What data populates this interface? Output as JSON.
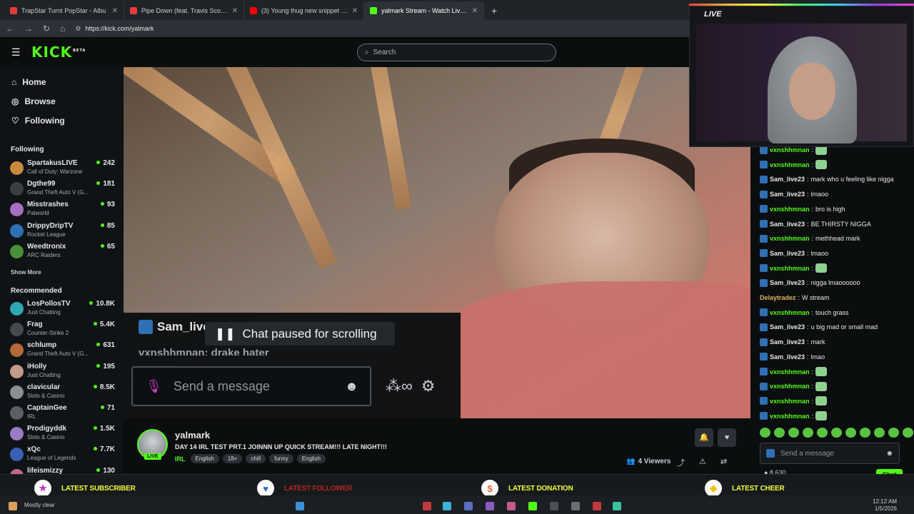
{
  "browser": {
    "tabs": [
      {
        "title": "TrapStar Turnt PopStar - Albu",
        "color": "#e63b3b"
      },
      {
        "title": "Pipe Down (feat. Travis Scott) - Sp",
        "color": "#e63b3b"
      },
      {
        "title": "(3) Young thug new snippet crazy",
        "color": "#ff0000"
      },
      {
        "title": "yalmark Stream - Watch Live on K",
        "color": "#53fc18"
      }
    ],
    "url": "https://kick.com/yalmark"
  },
  "header": {
    "logo": "KICK",
    "logo_badge": "BETA",
    "search_placeholder": "Search"
  },
  "sidebar": {
    "nav": [
      {
        "label": "Home",
        "icon": "home-icon"
      },
      {
        "label": "Browse",
        "icon": "compass-icon"
      },
      {
        "label": "Following",
        "icon": "heart-icon"
      }
    ],
    "following_title": "Following",
    "following": [
      {
        "name": "SpartakusLIVE",
        "game": "Call of Duty: Warzone",
        "viewers": "242",
        "color": "#c78a3c"
      },
      {
        "name": "Dgthe99",
        "game": "Grand Theft Auto V (G...",
        "viewers": "181",
        "color": "#3b3f44"
      },
      {
        "name": "Misstrashes",
        "game": "Palworld",
        "viewers": "93",
        "color": "#a66fc2"
      },
      {
        "name": "DrippyDripTV",
        "game": "Rocket League",
        "viewers": "85",
        "color": "#2f6fb3"
      },
      {
        "name": "Weedtronix",
        "game": "ARC Raiders",
        "viewers": "65",
        "color": "#4b8f3b"
      }
    ],
    "show_more": "Show More",
    "recommended_title": "Recommended",
    "recommended": [
      {
        "name": "LosPollosTV",
        "game": "Just Chatting",
        "viewers": "10.8K",
        "color": "#2fa7b3"
      },
      {
        "name": "Frag",
        "game": "Counter-Strike 2",
        "viewers": "5.4K",
        "color": "#444a50"
      },
      {
        "name": "schlump",
        "game": "Grand Theft Auto V (G...",
        "viewers": "631",
        "color": "#b36a3b"
      },
      {
        "name": "iHolly",
        "game": "Just Chatting",
        "viewers": "195",
        "color": "#c29a8a"
      },
      {
        "name": "clavicular",
        "game": "Slots & Casino",
        "viewers": "8.5K",
        "color": "#8a8f94"
      },
      {
        "name": "CaptainGee",
        "game": "IRL",
        "viewers": "71",
        "color": "#5a6066"
      },
      {
        "name": "Prodigyddk",
        "game": "Slots & Casino",
        "viewers": "1.5K",
        "color": "#9a7ac2"
      },
      {
        "name": "xQc",
        "game": "League of Legends",
        "viewers": "7.7K",
        "color": "#3b5fb3"
      },
      {
        "name": "lifeismizzy",
        "game": "",
        "viewers": "130",
        "color": "#c26a8a"
      }
    ]
  },
  "overlay": {
    "line1_user": "Sam_live",
    "paused_text": "Chat paused for scrolling",
    "line2": "vxnshhmnan: drake hater",
    "input_placeholder": "Send a message"
  },
  "stream": {
    "streamer": "yalmark",
    "live_badge": "LIVE",
    "title": "DAY 14 IRL TEST PRT.1 JOINNN UP QUICK STREAM!!! LATE NIGHT!!!",
    "category": "IRL",
    "tags": [
      "English",
      "18+",
      "chill",
      "funny",
      "English"
    ],
    "viewers": "4 Viewers"
  },
  "webcam": {
    "label": "LIVE"
  },
  "chat": {
    "messages": [
      {
        "user": "vxnshhmnan",
        "text": "",
        "emote": true,
        "color": "#53fc18"
      },
      {
        "user": "vxnshhmnan",
        "text": "",
        "emote": true,
        "color": "#53fc18"
      },
      {
        "user": "Sam_live23",
        "text": "mark who u feeling like nigga",
        "emote": false,
        "color": "#e6e8ea"
      },
      {
        "user": "Sam_live23",
        "text": "lmaoo",
        "emote": false,
        "color": "#e6e8ea"
      },
      {
        "user": "vxnshhmnan",
        "text": "bro is high",
        "emote": false,
        "color": "#53fc18"
      },
      {
        "user": "Sam_live23",
        "text": "BE THIRSTY NIGGA",
        "emote": false,
        "color": "#e6e8ea"
      },
      {
        "user": "vxnshhmnan",
        "text": "methhead mark",
        "emote": false,
        "color": "#53fc18"
      },
      {
        "user": "Sam_live23",
        "text": "lmaoo",
        "emote": false,
        "color": "#e6e8ea"
      },
      {
        "user": "vxnshhmnan",
        "text": "",
        "emote": true,
        "color": "#53fc18"
      },
      {
        "user": "Sam_live23",
        "text": "nigga lmaoooooo",
        "emote": false,
        "color": "#e6e8ea"
      },
      {
        "user": "Delaytradez",
        "text": "W stream",
        "emote": false,
        "color": "#e3b062",
        "nobadge": true
      },
      {
        "user": "vxnshhmnan",
        "text": "touch grass",
        "emote": false,
        "color": "#53fc18"
      },
      {
        "user": "Sam_live23",
        "text": "u big mad or small mad",
        "emote": false,
        "color": "#e6e8ea"
      },
      {
        "user": "Sam_live23",
        "text": "mark",
        "emote": false,
        "color": "#e6e8ea"
      },
      {
        "user": "Sam_live23",
        "text": "lmao",
        "emote": false,
        "color": "#e6e8ea"
      },
      {
        "user": "vxnshhmnan",
        "text": "",
        "emote": true,
        "color": "#53fc18"
      },
      {
        "user": "vxnshhmnan",
        "text": "",
        "emote": true,
        "color": "#53fc18"
      },
      {
        "user": "vxnshhmnan",
        "text": "",
        "emote": true,
        "color": "#53fc18"
      },
      {
        "user": "vxnshhmnan",
        "text": "",
        "emote": true,
        "color": "#53fc18"
      }
    ],
    "input_placeholder": "Send a message",
    "points": "8,630",
    "chat_button": "Chat"
  },
  "alerts": [
    {
      "label": "LATEST SUBSCRIBER",
      "icon": "star-icon",
      "color": "#c23bc2"
    },
    {
      "label": "LATEST FOLLOWER",
      "icon": "heart-icon",
      "color": "#2f6fb3"
    },
    {
      "label": "LATEST DONATION",
      "icon": "dollar-icon",
      "color": "#e06a3b"
    },
    {
      "label": "LATEST CHEER",
      "icon": "diamond-icon",
      "color": "#f2c21b"
    }
  ],
  "taskbar": {
    "weather": "Mostly clear",
    "time": "12:12 AM",
    "date": "1/5/2026"
  }
}
